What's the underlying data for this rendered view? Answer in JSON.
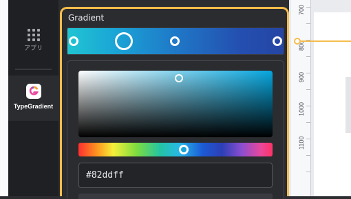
{
  "sidebar": {
    "items": [
      {
        "label": "アプリ",
        "icon": "apps-grid-icon"
      },
      {
        "label": "TypeGradient",
        "icon": "typegradient-app-icon",
        "selected": true
      }
    ]
  },
  "panel": {
    "title": "Gradient",
    "gradient_stops": [
      {
        "color": "#21c5d2",
        "selected": false
      },
      {
        "color": "#1aa5d6",
        "selected": true
      },
      {
        "color": "#1f78c7",
        "selected": false
      },
      {
        "color": "#2545a4",
        "selected": false
      }
    ],
    "picker": {
      "hex_value": "#82ddff"
    }
  },
  "canvas": {
    "ruler_labels": [
      "700",
      "800",
      "900",
      "1000",
      "1100"
    ]
  },
  "colors": {
    "accent": "#f6bd4c",
    "panel_bg": "#2b2c30",
    "sidebar_bg": "#1f2023"
  }
}
